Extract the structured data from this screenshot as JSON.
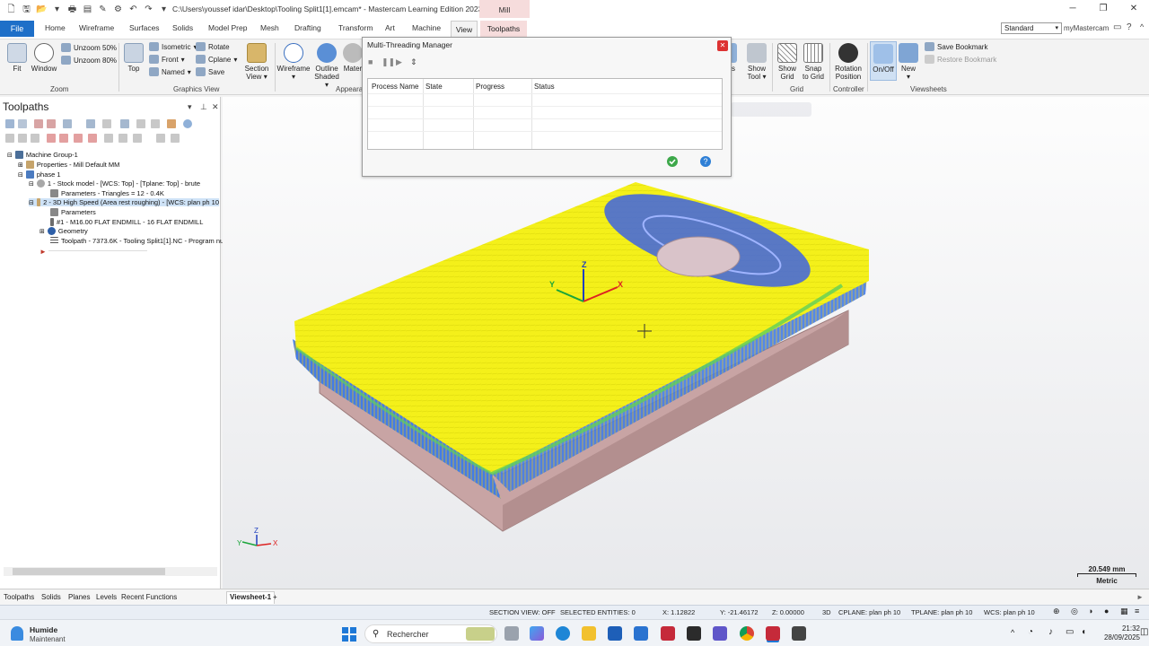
{
  "titlebar": {
    "path": "C:\\Users\\youssef idar\\Desktop\\Tooling Split1[1].emcam* - Mastercam Learning Edition 2023",
    "context_tab": "Mill"
  },
  "tabs": [
    "File",
    "Home",
    "Wireframe",
    "Surfaces",
    "Solids",
    "Model Prep",
    "Mesh",
    "Drafting",
    "Transform",
    "Art",
    "Machine",
    "View",
    "Toolpaths"
  ],
  "toolbar_right": {
    "standard": "Standard",
    "mymastercam": "myMastercam"
  },
  "ribbon": {
    "fit": "Fit",
    "window": "Window",
    "unzoom50": "Unzoom 50%",
    "unzoom80": "Unzoom 80%",
    "zoom_group": "Zoom",
    "top": "Top",
    "isometric": "Isometric",
    "front": "Front",
    "named": "Named",
    "rotate": "Rotate",
    "cplane": "Cplane",
    "save": "Save",
    "section_view_1": "Section",
    "section_view_2": "View",
    "graphics_view_group": "Graphics View",
    "wireframe": "Wireframe",
    "outline_1": "Outline",
    "outline_2": "Shaded",
    "mater": "Mater",
    "appearance_group": "Appeara",
    "show_tool_1": "Show",
    "show_tool_2": "Tool",
    "s_partial": "s",
    "show_grid_1": "Show",
    "show_grid_2": "Grid",
    "snap_1": "Snap",
    "snap_2": "to Grid",
    "grid_group": "Grid",
    "rotation_1": "Rotation",
    "rotation_2": "Position",
    "controller_group": "Controller",
    "onoff": "On/Off",
    "new": "New",
    "save_bookmark": "Save Bookmark",
    "restore_bookmark": "Restore Bookmark",
    "viewsheets_group": "Viewsheets"
  },
  "panel": {
    "title": "Toolpaths",
    "tree": [
      "Machine Group-1",
      "Properties - Mill Default MM",
      "phase 1",
      "1 - Stock model - [WCS: Top] - [Tplane: Top] - brute",
      "Parameters - Triangles = 12 - 0.4K",
      "2 - 3D High Speed (Area rest roughing) - [WCS: plan ph 10",
      "Parameters",
      "#1 - M16.00 FLAT ENDMILL - 16 FLAT ENDMILL",
      "Geometry",
      "Toolpath - 7373.6K - Tooling Split1[1].NC - Program nu"
    ]
  },
  "dialog": {
    "title": "Multi-Threading Manager",
    "columns": [
      "Process Name",
      "State",
      "Progress",
      "Status"
    ]
  },
  "viewport": {
    "scale_value": "20.549 mm",
    "scale_unit": "Metric",
    "axis_z": "Z",
    "axis_x": "X",
    "axis_y": "Y"
  },
  "bottom_tabs": [
    "Toolpaths",
    "Solids",
    "Planes",
    "Levels",
    "Recent Functions"
  ],
  "viewsheet": {
    "label": "Viewsheet-1",
    "add": "+"
  },
  "status": {
    "section": "SECTION VIEW: OFF",
    "selected": "SELECTED ENTITIES: 0",
    "x": "X:   1.12822",
    "y": "Y:   -21.46172",
    "z": "Z:   0.00000",
    "mode": "3D",
    "cplane": "CPLANE: plan ph 10",
    "tplane": "TPLANE: plan ph 10",
    "wcs": "WCS: plan ph 10"
  },
  "taskbar": {
    "weather_1": "Humide",
    "weather_2": "Maintenant",
    "search": "Rechercher",
    "time": "21:32",
    "date": "28/09/2025"
  },
  "colors": {
    "accent": "#1e6fc8",
    "context": "#f6dcdc",
    "toolpath_yellow": "#f4f01a",
    "toolpath_blue": "#3a5fe0",
    "stock": "#c9a8a8"
  }
}
